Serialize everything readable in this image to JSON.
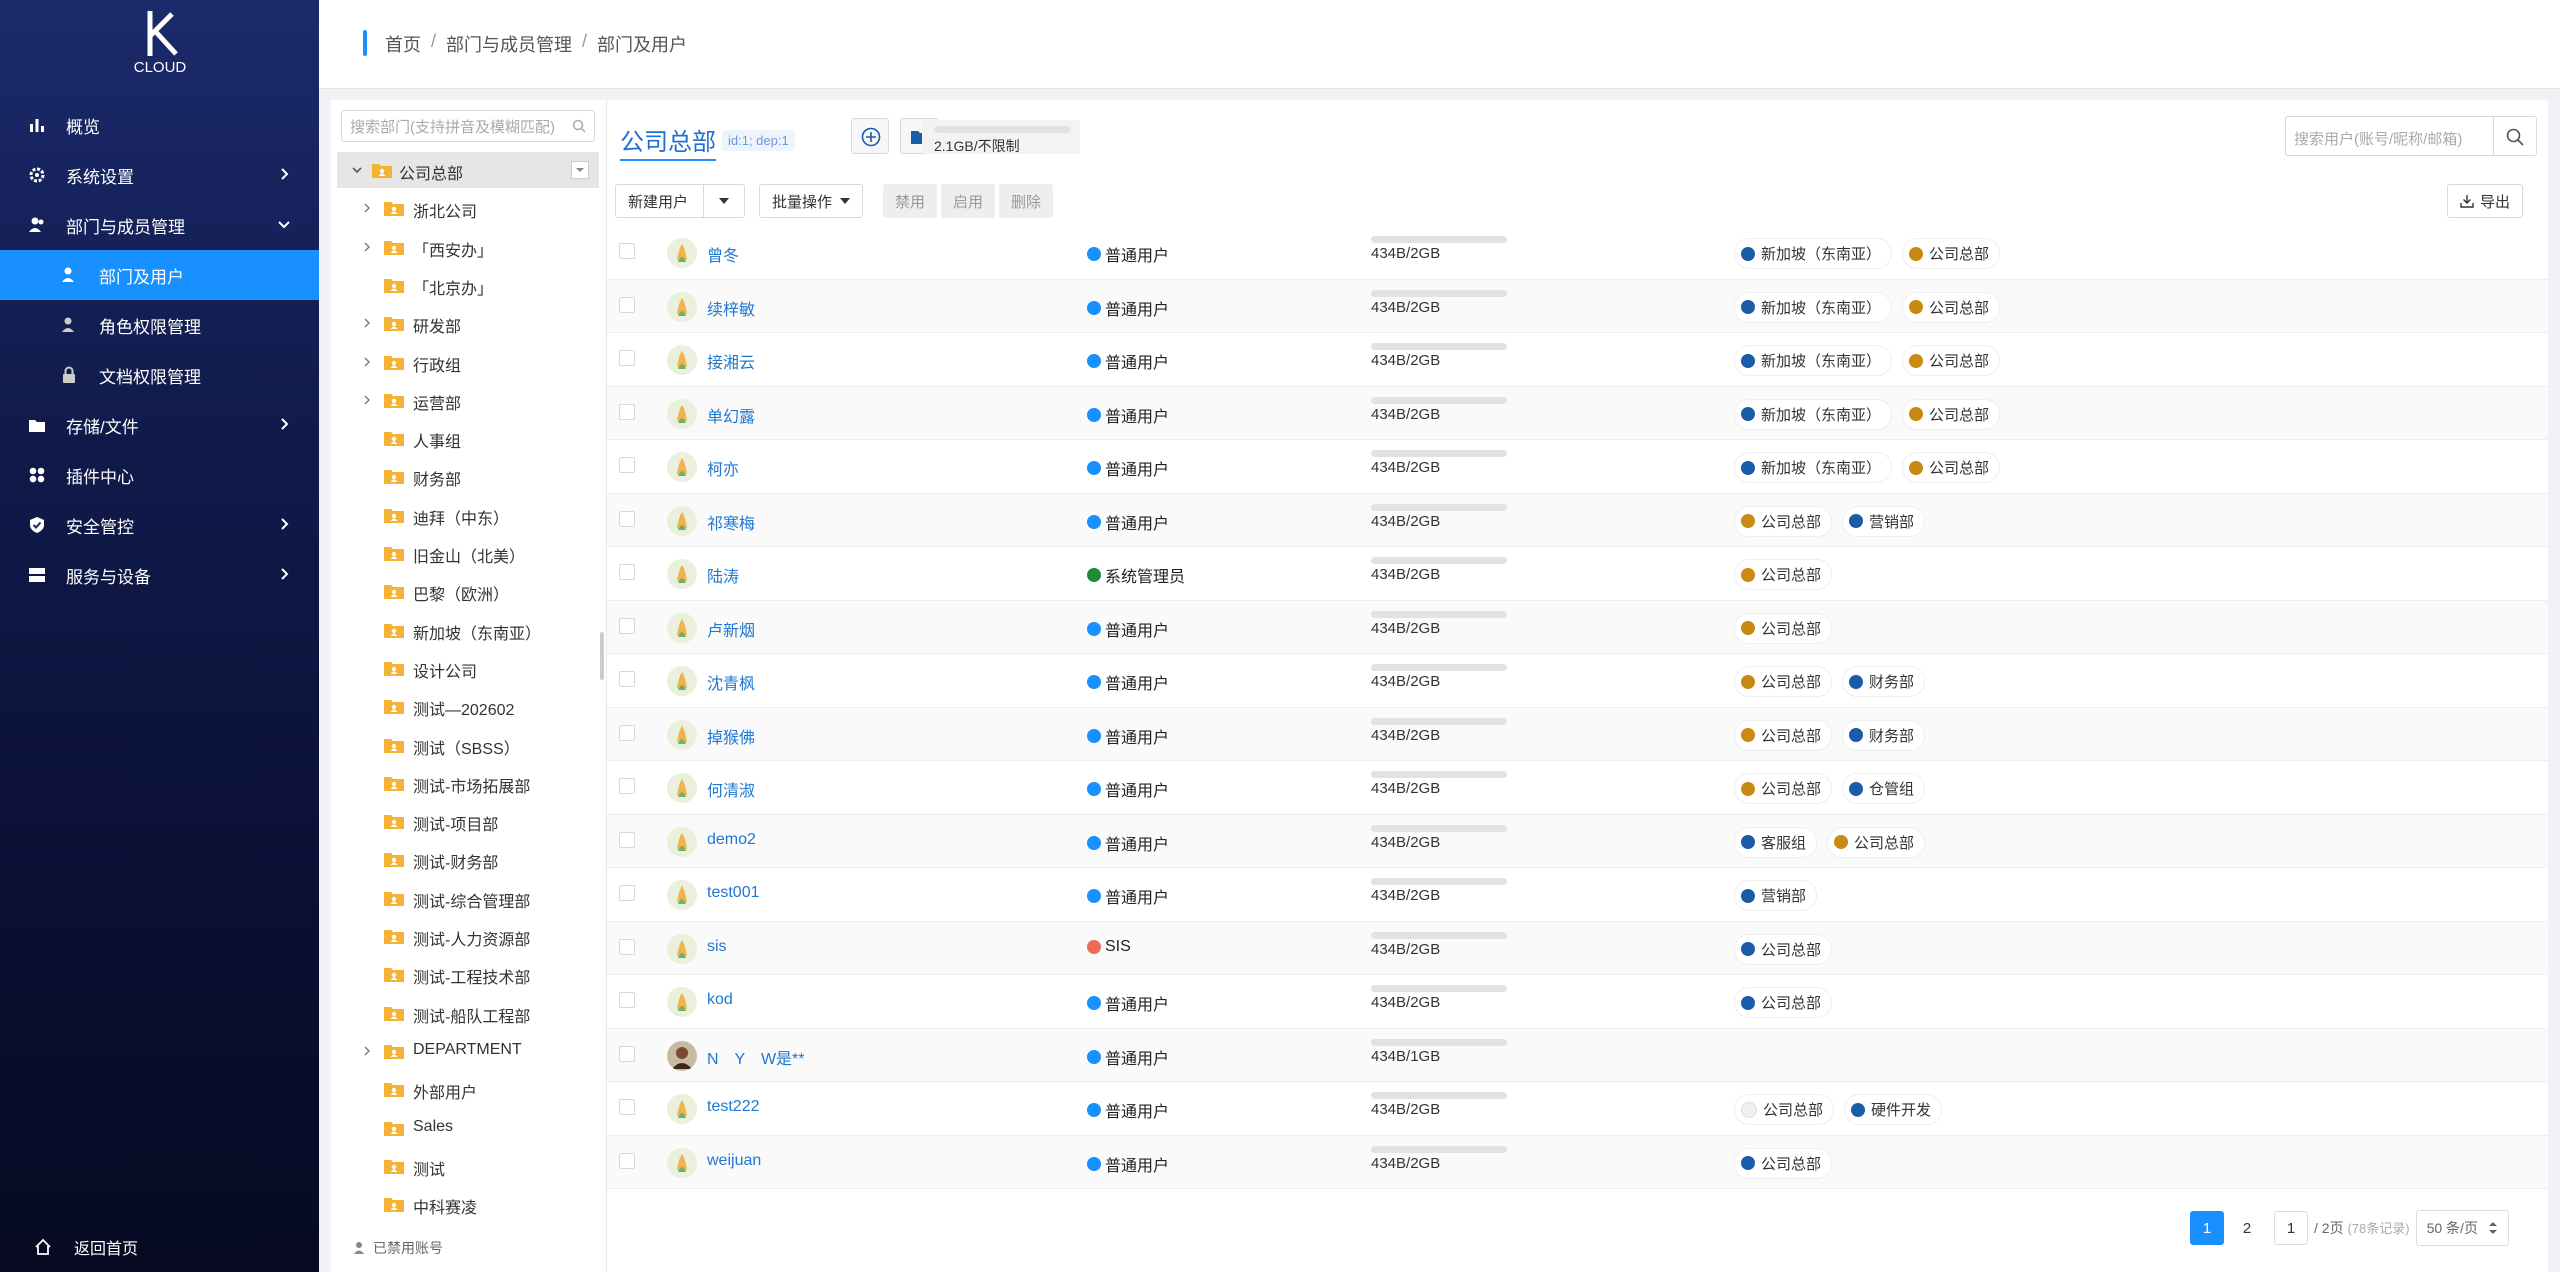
{
  "sidebar": {
    "logo_text": "CLOUD",
    "items": [
      {
        "label": "概览",
        "icon": "bar-chart-icon"
      },
      {
        "label": "系统设置",
        "icon": "gear-icon"
      },
      {
        "label": "部门与成员管理",
        "icon": "users-icon"
      },
      {
        "label": "部门及用户",
        "icon": "user-icon"
      },
      {
        "label": "角色权限管理",
        "icon": "user-role-icon"
      },
      {
        "label": "文档权限管理",
        "icon": "lock-icon"
      },
      {
        "label": "存储/文件",
        "icon": "folder-icon"
      },
      {
        "label": "插件中心",
        "icon": "grid-icon"
      },
      {
        "label": "安全管控",
        "icon": "shield-icon"
      },
      {
        "label": "服务与设备",
        "icon": "server-icon"
      }
    ],
    "back_home": "返回首页"
  },
  "header": {
    "crumbs": [
      "首页",
      "部门与成员管理",
      "部门及用户"
    ]
  },
  "tree": {
    "search_placeholder": "搜索部门(支持拼音及模糊匹配)",
    "root": "公司总部",
    "nodes": [
      "浙北公司",
      "「西安办」",
      "「北京办」",
      "研发部",
      "行政组",
      "运营部",
      "人事组",
      "财务部",
      "迪拜（中东）",
      "旧金山（北美）",
      "巴黎（欧洲）",
      "新加坡（东南亚）",
      "设计公司",
      "测试—202602",
      "测试（SBSS）",
      "测试-市场拓展部",
      "测试-项目部",
      "测试-财务部",
      "测试-综合管理部",
      "测试-人力资源部",
      "测试-工程技术部",
      "测试-船队工程部",
      "DEPARTMENT",
      "外部用户",
      "Sales",
      "测试",
      "中科赛凌"
    ],
    "disabled_accounts": "已禁用账号"
  },
  "main": {
    "title": "公司总部",
    "id_tag": "id:1; dep:1",
    "quota": "2.1GB/不限制",
    "user_search_placeholder": "搜索用户(账号/昵称/邮箱)",
    "buttons": {
      "new_user": "新建用户",
      "batch": "批量操作",
      "disable": "禁用",
      "enable": "启用",
      "delete": "删除",
      "export": "导出"
    }
  },
  "colors": {
    "blue": "#1890ff",
    "navy": "#1a5ca6",
    "orange": "#c98a14",
    "green": "#1f8a3a",
    "red": "#f06a5a",
    "white": "#f0f0f0"
  },
  "users": [
    {
      "name": "曾冬",
      "role": "普通用户",
      "cap": "434B/2GB",
      "tags": [
        [
          "新加坡（东南亚）",
          "navy"
        ],
        [
          "公司总部",
          "orange"
        ]
      ]
    },
    {
      "name": "续梓敏",
      "role": "普通用户",
      "cap": "434B/2GB",
      "tags": [
        [
          "新加坡（东南亚）",
          "navy"
        ],
        [
          "公司总部",
          "orange"
        ]
      ]
    },
    {
      "name": "接湘云",
      "role": "普通用户",
      "cap": "434B/2GB",
      "tags": [
        [
          "新加坡（东南亚）",
          "navy"
        ],
        [
          "公司总部",
          "orange"
        ]
      ]
    },
    {
      "name": "单幻露",
      "role": "普通用户",
      "cap": "434B/2GB",
      "tags": [
        [
          "新加坡（东南亚）",
          "navy"
        ],
        [
          "公司总部",
          "orange"
        ]
      ]
    },
    {
      "name": "柯亦",
      "role": "普通用户",
      "cap": "434B/2GB",
      "tags": [
        [
          "新加坡（东南亚）",
          "navy"
        ],
        [
          "公司总部",
          "orange"
        ]
      ]
    },
    {
      "name": "祁寒梅",
      "role": "普通用户",
      "cap": "434B/2GB",
      "tags": [
        [
          "公司总部",
          "orange"
        ],
        [
          "营销部",
          "navy"
        ]
      ]
    },
    {
      "name": "陆涛",
      "role": "系统管理员",
      "role_color": "green",
      "cap": "434B/2GB",
      "tags": [
        [
          "公司总部",
          "orange"
        ]
      ]
    },
    {
      "name": "卢新烟",
      "role": "普通用户",
      "cap": "434B/2GB",
      "tags": [
        [
          "公司总部",
          "orange"
        ]
      ]
    },
    {
      "name": "沈青枫",
      "role": "普通用户",
      "cap": "434B/2GB",
      "tags": [
        [
          "公司总部",
          "orange"
        ],
        [
          "财务部",
          "navy"
        ]
      ]
    },
    {
      "name": "掉猴佛",
      "role": "普通用户",
      "cap": "434B/2GB",
      "tags": [
        [
          "公司总部",
          "orange"
        ],
        [
          "财务部",
          "navy"
        ]
      ]
    },
    {
      "name": "何清淑",
      "role": "普通用户",
      "cap": "434B/2GB",
      "tags": [
        [
          "公司总部",
          "orange"
        ],
        [
          "仓管组",
          "navy"
        ]
      ]
    },
    {
      "name": "demo2",
      "role": "普通用户",
      "cap": "434B/2GB",
      "tags": [
        [
          "客服组",
          "navy"
        ],
        [
          "公司总部",
          "orange"
        ]
      ]
    },
    {
      "name": "test001",
      "role": "普通用户",
      "cap": "434B/2GB",
      "tags": [
        [
          "营销部",
          "navy"
        ]
      ]
    },
    {
      "name": "sis",
      "role": "SIS",
      "role_color": "red",
      "cap": "434B/2GB",
      "tags": [
        [
          "公司总部",
          "navy"
        ]
      ]
    },
    {
      "name": "kod",
      "role": "普通用户",
      "cap": "434B/2GB",
      "tags": [
        [
          "公司总部",
          "navy"
        ]
      ]
    },
    {
      "name": "N　Y　W是**",
      "role": "普通用户",
      "cap": "434B/1GB",
      "tags": [],
      "photo": true
    },
    {
      "name": "test222",
      "role": "普通用户",
      "cap": "434B/2GB",
      "tags": [
        [
          "公司总部",
          "white"
        ],
        [
          "硬件开发",
          "navy"
        ]
      ]
    },
    {
      "name": "weijuan",
      "role": "普通用户",
      "cap": "434B/2GB",
      "tags": [
        [
          "公司总部",
          "navy"
        ]
      ]
    }
  ],
  "pager": {
    "pages": [
      "1",
      "2"
    ],
    "jump": "1",
    "total": "/ 2页",
    "records": "(78条记录)",
    "size": "50 条/页"
  }
}
